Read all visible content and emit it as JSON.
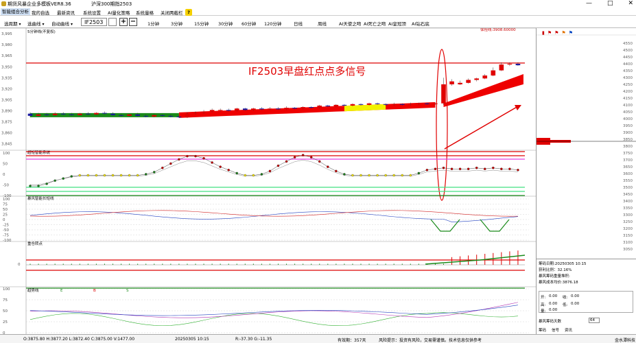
{
  "window": {
    "app_title": "期货风暴企业多模板VER8.36",
    "center_title": "沪深300期指2503",
    "minimize": "—",
    "maximize": "□",
    "close": "✕"
  },
  "menu": {
    "items": [
      "智能组合分析",
      "我的自选",
      "最新资讯",
      "系统设置",
      "AI量化策略",
      "系统量格",
      "关闭两截栏"
    ],
    "help": "?"
  },
  "toolbar": {
    "select_period": "选周期",
    "select_line": "选曲线",
    "auto_curve": "自动曲线",
    "code": "IF2503",
    "plus": "+",
    "minus": "−",
    "periods": [
      "1分钟",
      "3分钟",
      "15分钟",
      "30分钟",
      "60分钟",
      "120分钟",
      "日线",
      "周线"
    ],
    "ai_tools": [
      "AI天使之吻",
      "AI死亡之吻",
      "AI皇冠顶",
      "AI钻石底"
    ]
  },
  "chart_data": {
    "type": "candlestick",
    "contract": "IF2503",
    "main_panel": {
      "label": "5分钟线(不复权)",
      "ylim": [
        3838,
        3997
      ],
      "y_ticks": [
        "3,995",
        "3,980",
        "3,965",
        "3,950",
        "3,935",
        "3,920",
        "3,905",
        "3,890",
        "3,875",
        "3,860",
        "3,845"
      ],
      "right_label": "保险线:3908.60000",
      "annotation": "IF2503早盘红点点多信号",
      "candles": [
        {
          "o": 3886,
          "c": 3883,
          "h": 3888,
          "l": 3881
        },
        {
          "o": 3883,
          "c": 3885,
          "h": 3887,
          "l": 3882
        },
        {
          "o": 3885,
          "c": 3884,
          "h": 3887,
          "l": 3883
        },
        {
          "o": 3884,
          "c": 3886,
          "h": 3888,
          "l": 3883
        },
        {
          "o": 3886,
          "c": 3885,
          "h": 3888,
          "l": 3884
        },
        {
          "o": 3885,
          "c": 3884,
          "h": 3887,
          "l": 3883
        },
        {
          "o": 3884,
          "c": 3886,
          "h": 3887,
          "l": 3883
        },
        {
          "o": 3886,
          "c": 3885,
          "h": 3888,
          "l": 3884
        },
        {
          "o": 3885,
          "c": 3887,
          "h": 3888,
          "l": 3884
        },
        {
          "o": 3887,
          "c": 3886,
          "h": 3889,
          "l": 3885
        },
        {
          "o": 3886,
          "c": 3884,
          "h": 3888,
          "l": 3883
        },
        {
          "o": 3884,
          "c": 3883,
          "h": 3886,
          "l": 3882
        },
        {
          "o": 3883,
          "c": 3885,
          "h": 3886,
          "l": 3882
        },
        {
          "o": 3885,
          "c": 3883,
          "h": 3887,
          "l": 3882
        },
        {
          "o": 3883,
          "c": 3882,
          "h": 3885,
          "l": 3881
        },
        {
          "o": 3882,
          "c": 3884,
          "h": 3886,
          "l": 3881
        },
        {
          "o": 3884,
          "c": 3883,
          "h": 3885,
          "l": 3882
        },
        {
          "o": 3883,
          "c": 3882,
          "h": 3885,
          "l": 3881
        },
        {
          "o": 3882,
          "c": 3881,
          "h": 3884,
          "l": 3880
        },
        {
          "o": 3881,
          "c": 3886,
          "h": 3888,
          "l": 3880
        },
        {
          "o": 3886,
          "c": 3887,
          "h": 3889,
          "l": 3885
        },
        {
          "o": 3887,
          "c": 3889,
          "h": 3891,
          "l": 3886
        },
        {
          "o": 3889,
          "c": 3891,
          "h": 3893,
          "l": 3888
        },
        {
          "o": 3891,
          "c": 3891,
          "h": 3893,
          "l": 3889
        },
        {
          "o": 3891,
          "c": 3890,
          "h": 3893,
          "l": 3889
        },
        {
          "o": 3890,
          "c": 3893,
          "h": 3894,
          "l": 3889
        },
        {
          "o": 3893,
          "c": 3891,
          "h": 3894,
          "l": 3890
        },
        {
          "o": 3891,
          "c": 3893,
          "h": 3894,
          "l": 3890
        },
        {
          "o": 3893,
          "c": 3892,
          "h": 3895,
          "l": 3891
        },
        {
          "o": 3892,
          "c": 3893,
          "h": 3895,
          "l": 3891
        },
        {
          "o": 3893,
          "c": 3892,
          "h": 3895,
          "l": 3891
        },
        {
          "o": 3892,
          "c": 3894,
          "h": 3896,
          "l": 3891
        },
        {
          "o": 3894,
          "c": 3893,
          "h": 3895,
          "l": 3892
        },
        {
          "o": 3893,
          "c": 3895,
          "h": 3896,
          "l": 3892
        },
        {
          "o": 3895,
          "c": 3894,
          "h": 3896,
          "l": 3893
        },
        {
          "o": 3894,
          "c": 3897,
          "h": 3898,
          "l": 3893
        },
        {
          "o": 3897,
          "c": 3896,
          "h": 3898,
          "l": 3895
        },
        {
          "o": 3896,
          "c": 3898,
          "h": 3899,
          "l": 3895
        },
        {
          "o": 3898,
          "c": 3897,
          "h": 3899,
          "l": 3896
        },
        {
          "o": 3897,
          "c": 3899,
          "h": 3900,
          "l": 3896
        },
        {
          "o": 3899,
          "c": 3898,
          "h": 3900,
          "l": 3897
        },
        {
          "o": 3898,
          "c": 3900,
          "h": 3901,
          "l": 3897
        },
        {
          "o": 3900,
          "c": 3899,
          "h": 3901,
          "l": 3898
        },
        {
          "o": 3899,
          "c": 3898,
          "h": 3900,
          "l": 3897
        },
        {
          "o": 3898,
          "c": 3899,
          "h": 3901,
          "l": 3897
        },
        {
          "o": 3899,
          "c": 3898,
          "h": 3900,
          "l": 3897
        },
        {
          "o": 3898,
          "c": 3899,
          "h": 3901,
          "l": 3897
        },
        {
          "o": 3899,
          "c": 3900,
          "h": 3901,
          "l": 3898
        },
        {
          "o": 3900,
          "c": 3899,
          "h": 3901,
          "l": 3898
        },
        {
          "o": 3899,
          "c": 3900,
          "h": 3901,
          "l": 3898
        },
        {
          "o": 3900,
          "c": 3926,
          "h": 3935,
          "l": 3898
        },
        {
          "o": 3926,
          "c": 3930,
          "h": 3933,
          "l": 3924
        },
        {
          "o": 3926,
          "c": 3928,
          "h": 3931,
          "l": 3925
        },
        {
          "o": 3928,
          "c": 3932,
          "h": 3934,
          "l": 3927
        },
        {
          "o": 3932,
          "c": 3934,
          "h": 3935,
          "l": 3930
        },
        {
          "o": 3934,
          "c": 3938,
          "h": 3940,
          "l": 3933
        },
        {
          "o": 3938,
          "c": 3945,
          "h": 3949,
          "l": 3937
        },
        {
          "o": 3945,
          "c": 3953,
          "h": 3956,
          "l": 3944
        },
        {
          "o": 3953,
          "c": 3954,
          "h": 3956,
          "l": 3951
        },
        {
          "o": 3954,
          "c": 3952,
          "h": 3956,
          "l": 3951
        }
      ]
    },
    "panel2": {
      "label": "超短智能系统",
      "ylim": [
        -100,
        100
      ],
      "dots": [
        -55,
        -55,
        -45,
        -30,
        -20,
        -10,
        -5,
        -5,
        -5,
        -5,
        -5,
        -5,
        -5,
        -5,
        0,
        10,
        30,
        50,
        70,
        85,
        85,
        75,
        55,
        35,
        20,
        5,
        -5,
        -5,
        0,
        15,
        40,
        60,
        80,
        90,
        80,
        60,
        35,
        15,
        0,
        -5,
        -5,
        -5,
        -5,
        -5,
        -5,
        -5,
        -5,
        5,
        20,
        25,
        30,
        25,
        25,
        25,
        30,
        25,
        30,
        25,
        25,
        20
      ]
    },
    "panel3": {
      "label": "暴风智能长短线",
      "y_ticks": [
        "100",
        "75",
        "50",
        "25",
        "0",
        "-25",
        "-50",
        "-75",
        "-100"
      ]
    },
    "panel4": {
      "label": "重仓转点",
      "y_ticks": [
        "0"
      ]
    },
    "panel5": {
      "label": "趋势线",
      "markers": [
        "E",
        "B",
        "S"
      ],
      "y_ticks": [
        "100",
        "75",
        "50",
        "25",
        "0"
      ]
    }
  },
  "side_axis": {
    "ticks": [
      "4550",
      "4500",
      "4450",
      "4400",
      "4350",
      "4300",
      "4250",
      "4200",
      "4150",
      "4100",
      "4050",
      "4000",
      "3950",
      "3900",
      "3850",
      "3800",
      "3750",
      "3700",
      "3650",
      "3600",
      "3550",
      "3500",
      "3450",
      "3400",
      "3350",
      "3300",
      "3250",
      "3200",
      "3150",
      "3100",
      "3050"
    ]
  },
  "side_info": {
    "date": "筹码日期:20250305 10:15",
    "profit_ratio": "获利比例：32.16%",
    "cost_label": "暴风筹码重量堆积:",
    "avg_cost": "暴风成本均价:3876.18",
    "open_label": "开:",
    "open_value": "0.00",
    "close_label": "收:",
    "close_value": "0.00",
    "high_label": "高:",
    "high_value": "0.00",
    "low_label": "低:",
    "low_value": "0.00",
    "vol_label": "量:",
    "vol_value": "0.00",
    "days_label": "暴风筹码天数",
    "days_value": "64",
    "tabs": [
      "筹码",
      "信号",
      "资讯"
    ]
  },
  "status": {
    "ohlc": "O:3875.80  H:3877.20  L:3872.40  C:3875.00  V:1477.00",
    "time": "20250305 10:15",
    "rg": "R:-37.30  G:-11.35",
    "valid": "有效期：357天",
    "risk": "风险提示：投资有风险，交易需谨慎。技术信息仅供参考",
    "brand": "金水潭科技"
  }
}
